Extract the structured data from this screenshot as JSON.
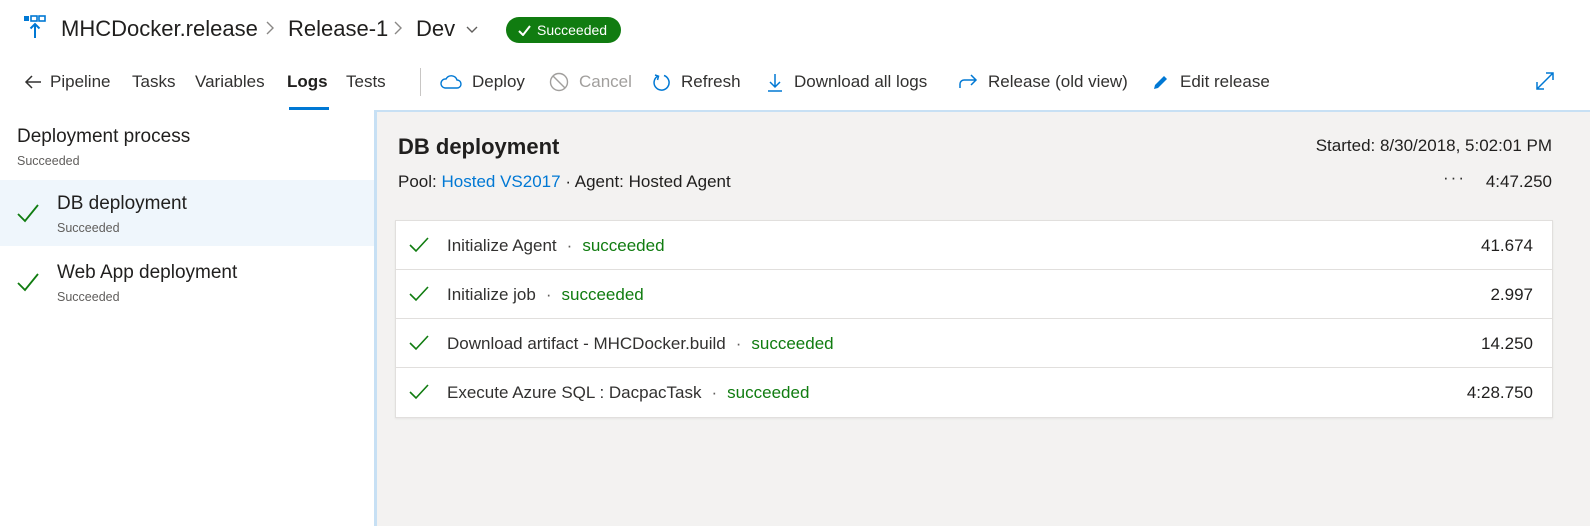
{
  "header": {
    "breadcrumbs": [
      "MHCDocker.release",
      "Release-1",
      "Dev"
    ],
    "status_badge": "Succeeded"
  },
  "toolbar": {
    "tabs": [
      {
        "label": "Pipeline",
        "icon": "arrow-left-icon"
      },
      {
        "label": "Tasks"
      },
      {
        "label": "Variables"
      },
      {
        "label": "Logs",
        "active": true
      },
      {
        "label": "Tests"
      }
    ],
    "actions": [
      {
        "label": "Deploy",
        "icon": "cloud-icon"
      },
      {
        "label": "Cancel",
        "icon": "cancel-icon",
        "disabled": true
      },
      {
        "label": "Refresh",
        "icon": "refresh-icon"
      },
      {
        "label": "Download all logs",
        "icon": "download-icon"
      },
      {
        "label": "Release (old view)",
        "icon": "redo-arrow-icon"
      },
      {
        "label": "Edit release",
        "icon": "pencil-icon"
      }
    ]
  },
  "left_panel": {
    "title": "Deployment process",
    "status": "Succeeded",
    "stages": [
      {
        "name": "DB deployment",
        "status": "Succeeded",
        "selected": true
      },
      {
        "name": "Web App deployment",
        "status": "Succeeded"
      }
    ]
  },
  "job": {
    "title": "DB deployment",
    "pool_label": "Pool:",
    "pool": "Hosted VS2017",
    "agent": "· Agent: Hosted Agent",
    "started": "Started: 8/30/2018, 5:02:01 PM",
    "more": "···",
    "duration": "4:47.250",
    "tasks": [
      {
        "name": "Initialize Agent",
        "status": "succeeded",
        "duration": "41.674"
      },
      {
        "name": "Initialize job",
        "status": "succeeded",
        "duration": "2.997"
      },
      {
        "name": "Download artifact - MHCDocker.build",
        "status": "succeeded",
        "duration": "14.250"
      },
      {
        "name": "Execute Azure SQL : DacpacTask",
        "status": "succeeded",
        "duration": "4:28.750"
      }
    ]
  },
  "colors": {
    "accent": "#0078d4",
    "success": "#107c10",
    "selected_bg": "#eff6fc",
    "panel_bg": "#f3f2f1"
  }
}
